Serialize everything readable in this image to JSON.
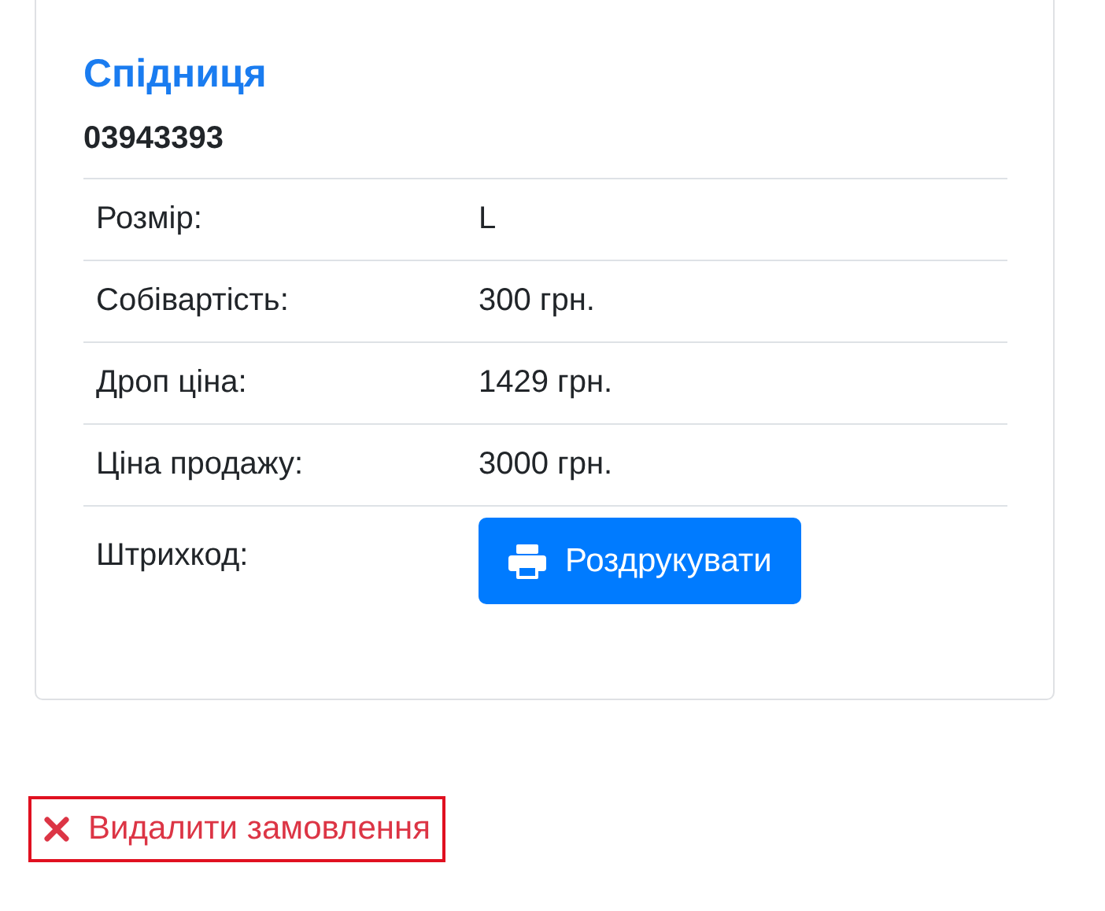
{
  "product": {
    "title": "Спідниця",
    "code": "03943393",
    "rows": [
      {
        "kind": "text",
        "label": "Розмір:",
        "value": "L"
      },
      {
        "kind": "text",
        "label": "Собівартість:",
        "value": "300 грн."
      },
      {
        "kind": "text",
        "label": "Дроп ціна:",
        "value": "1429 грн."
      },
      {
        "kind": "text",
        "label": "Ціна продажу:",
        "value": "3000 грн."
      },
      {
        "kind": "button",
        "label": "Штрихкод:",
        "value": "Роздрукувати"
      }
    ]
  },
  "delete_link": {
    "label": "Видалити замовлення"
  }
}
